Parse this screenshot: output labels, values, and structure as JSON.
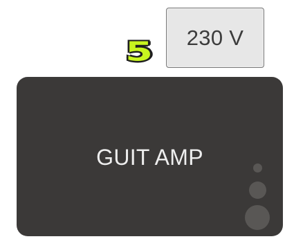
{
  "step": {
    "number": "5",
    "color": "#c8f51f"
  },
  "voltage_card": {
    "label": "230 V",
    "background": "#e7e7e7",
    "border": "#777777"
  },
  "amp_card": {
    "label": "GUIT AMP",
    "background": "#3b3938",
    "indicator_color": "#595755"
  }
}
